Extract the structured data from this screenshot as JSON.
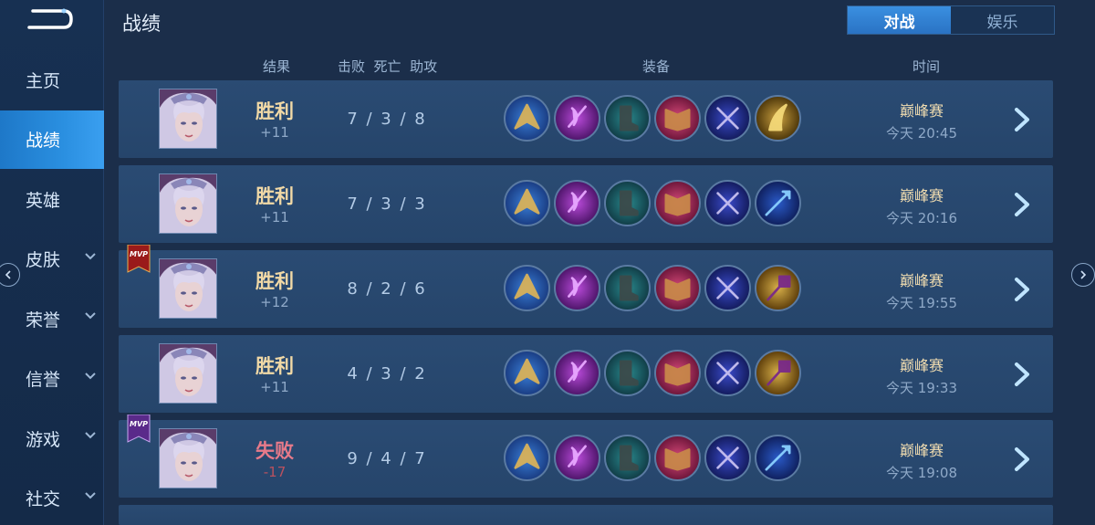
{
  "header": {
    "title": "战绩"
  },
  "tabs": [
    {
      "label": "对战",
      "active": true
    },
    {
      "label": "娱乐",
      "active": false
    }
  ],
  "sidebar": {
    "items": [
      {
        "label": "主页",
        "has_chevron": false,
        "active": false
      },
      {
        "label": "战绩",
        "has_chevron": false,
        "active": true
      },
      {
        "label": "英雄",
        "has_chevron": false,
        "active": false
      },
      {
        "label": "皮肤",
        "has_chevron": true,
        "active": false
      },
      {
        "label": "荣誉",
        "has_chevron": true,
        "active": false
      },
      {
        "label": "信誉",
        "has_chevron": true,
        "active": false
      },
      {
        "label": "游戏",
        "has_chevron": true,
        "active": false
      },
      {
        "label": "社交",
        "has_chevron": true,
        "active": false
      }
    ]
  },
  "columns": {
    "result": "结果",
    "kda": "击败  死亡  助攻",
    "items": "装备",
    "time": "时间"
  },
  "matches": [
    {
      "result": "胜利",
      "outcome": "win",
      "points": "+11",
      "kda": "7 / 3 / 8",
      "mode": "巅峰赛",
      "time": "今天 20:45",
      "mvp": "none",
      "items": [
        "gold-blue",
        "purple",
        "teal-boots",
        "pink-book",
        "navy-cross",
        "gold-claw"
      ]
    },
    {
      "result": "胜利",
      "outcome": "win",
      "points": "+11",
      "kda": "7 / 3 / 3",
      "mode": "巅峰赛",
      "time": "今天 20:16",
      "mvp": "none",
      "items": [
        "gold-blue",
        "purple",
        "teal-boots",
        "pink-book",
        "navy-cross",
        "blue-spear"
      ]
    },
    {
      "result": "胜利",
      "outcome": "win",
      "points": "+12",
      "kda": "8 / 2 / 6",
      "mode": "巅峰赛",
      "time": "今天 19:55",
      "mvp": "red",
      "items": [
        "gold-blue",
        "purple",
        "teal-boots",
        "pink-book",
        "navy-cross",
        "gold-wand"
      ]
    },
    {
      "result": "胜利",
      "outcome": "win",
      "points": "+11",
      "kda": "4 / 3 / 2",
      "mode": "巅峰赛",
      "time": "今天 19:33",
      "mvp": "none",
      "items": [
        "gold-blue",
        "purple",
        "teal-boots",
        "pink-book",
        "navy-cross",
        "gold-wand"
      ]
    },
    {
      "result": "失败",
      "outcome": "lose",
      "points": "-17",
      "kda": "9 / 4 / 7",
      "mode": "巅峰赛",
      "time": "今天 19:08",
      "mvp": "purple",
      "items": [
        "gold-blue",
        "purple",
        "teal-boots",
        "pink-book",
        "navy-cross",
        "blue-spear"
      ]
    }
  ],
  "mvp_label": "MVP",
  "colors": {
    "win": "#f1d9a6",
    "lose": "#e77a8a",
    "accent": "#2a8fe0"
  }
}
